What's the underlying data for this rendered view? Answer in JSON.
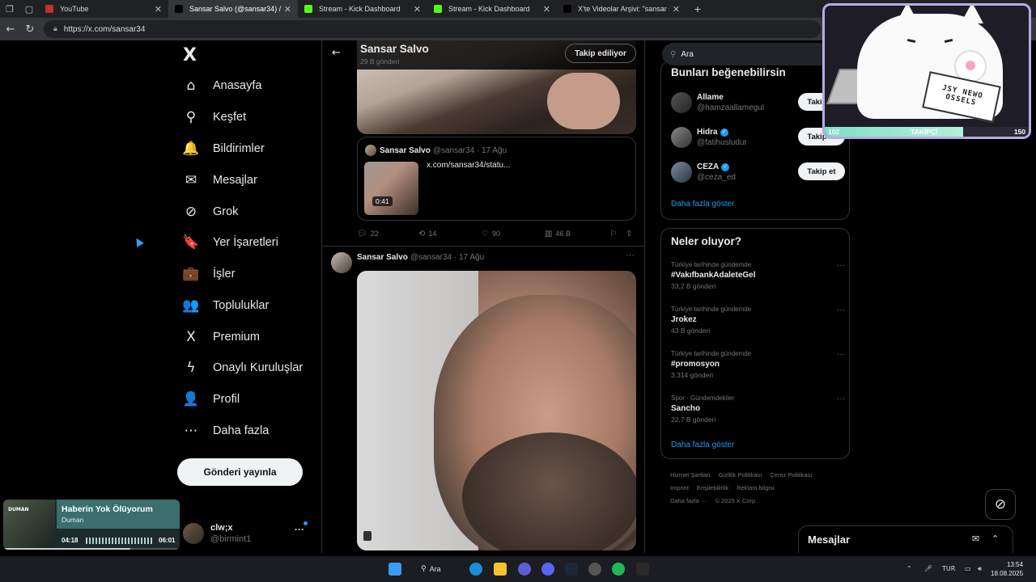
{
  "browser": {
    "tabs": [
      {
        "title": "YouTube",
        "favicon_color": "#c4302b",
        "active": false
      },
      {
        "title": "Sansar Salvo (@sansar34) / X",
        "favicon_color": "#000000",
        "active": true
      },
      {
        "title": "Stream - Kick Dashboard",
        "favicon_color": "#53fc18",
        "active": false
      },
      {
        "title": "Stream - Kick Dashboard",
        "favicon_color": "#53fc18",
        "active": false
      },
      {
        "title": "X'te Videolar Arşivi: \"sansar salvo",
        "favicon_color": "#000000",
        "active": false
      }
    ],
    "url": "https://x.com/sansar34"
  },
  "sidebar": {
    "logo": "X",
    "items": [
      {
        "label": "Anasayfa",
        "icon": "⌂"
      },
      {
        "label": "Keşfet",
        "icon": "⚲"
      },
      {
        "label": "Bildirimler",
        "icon": "🔔"
      },
      {
        "label": "Mesajlar",
        "icon": "✉"
      },
      {
        "label": "Grok",
        "icon": "⊘"
      },
      {
        "label": "Yer İşaretleri",
        "icon": "🔖"
      },
      {
        "label": "İşler",
        "icon": "💼"
      },
      {
        "label": "Topluluklar",
        "icon": "👥"
      },
      {
        "label": "Premium",
        "icon": "X"
      },
      {
        "label": "Onaylı Kuruluşlar",
        "icon": "ϟ"
      },
      {
        "label": "Profil",
        "icon": "👤"
      },
      {
        "label": "Daha fazla",
        "icon": "⋯"
      }
    ],
    "post_button": "Gönderi yayınla",
    "account": {
      "name": "clw;x",
      "handle": "@birmint1"
    }
  },
  "profile_header": {
    "name": "Sansar Salvo",
    "post_count": "29 B gönderi",
    "follow_state": "Takip ediliyor"
  },
  "tweet1": {
    "quote": {
      "name": "Sansar Salvo",
      "handle": "@sansar34 · 17 Ağu",
      "text": "x.com/sansar34/statu...",
      "duration": "0:41"
    },
    "actions": {
      "replies": "22",
      "retweets": "14",
      "likes": "90",
      "views": "46 B"
    }
  },
  "tweet2": {
    "name": "Sansar Salvo",
    "handle": "@sansar34 · 17 Ağu"
  },
  "right": {
    "search_placeholder": "Ara",
    "who_to_follow": {
      "title": "Bunları beğenebilirsin",
      "users": [
        {
          "name": "Allame",
          "handle": "@hamzaallamegul",
          "verified": false,
          "button": "Takip et"
        },
        {
          "name": "Hidra",
          "handle": "@fatihusludur",
          "verified": true,
          "button": "Takip et"
        },
        {
          "name": "CEZA",
          "handle": "@ceza_ed",
          "verified": true,
          "button": "Takip et"
        }
      ],
      "more": "Daha fazla göster"
    },
    "trends": {
      "title": "Neler oluyor?",
      "items": [
        {
          "context": "Türkiye tarihinde gündemde",
          "title": "#VakıfbankAdaleteGel",
          "count": "33,2 B gönderi"
        },
        {
          "context": "Türkiye tarihinde gündemde",
          "title": "Jrokez",
          "count": "43 B gönderi"
        },
        {
          "context": "Türkiye tarihinde gündemde",
          "title": "#promosyon",
          "count": "3.314 gönderi"
        },
        {
          "context": "Spor · Gündemdekiler",
          "title": "Sancho",
          "count": "22,7 B gönderi"
        }
      ],
      "more": "Daha fazla göster"
    },
    "footer": {
      "links": [
        "Hizmet Şartları",
        "Gizlilik Politikası",
        "Çerez Politikası",
        "Imprint",
        "Erişilebilirlik",
        "Reklam bilgisi",
        "Daha fazla ···"
      ],
      "copyright": "© 2025 X Corp."
    }
  },
  "messages_dock": {
    "title": "Mesajlar"
  },
  "overlay": {
    "keyboard_text": "JSY NEWO OSSELS",
    "follower_label": "TAKİPÇİ",
    "follower_current": "102",
    "follower_goal": "150",
    "follower_progress": 0.68
  },
  "media_widget": {
    "art_label": "DUMAN",
    "title": "Haberin Yok Ölüyorum",
    "artist": "Duman",
    "elapsed": "04:18",
    "total": "06:01",
    "progress": 0.72
  },
  "taskbar": {
    "search": "Ara",
    "lang": "TUR",
    "time": "13:54",
    "date": "18.08.2025"
  }
}
